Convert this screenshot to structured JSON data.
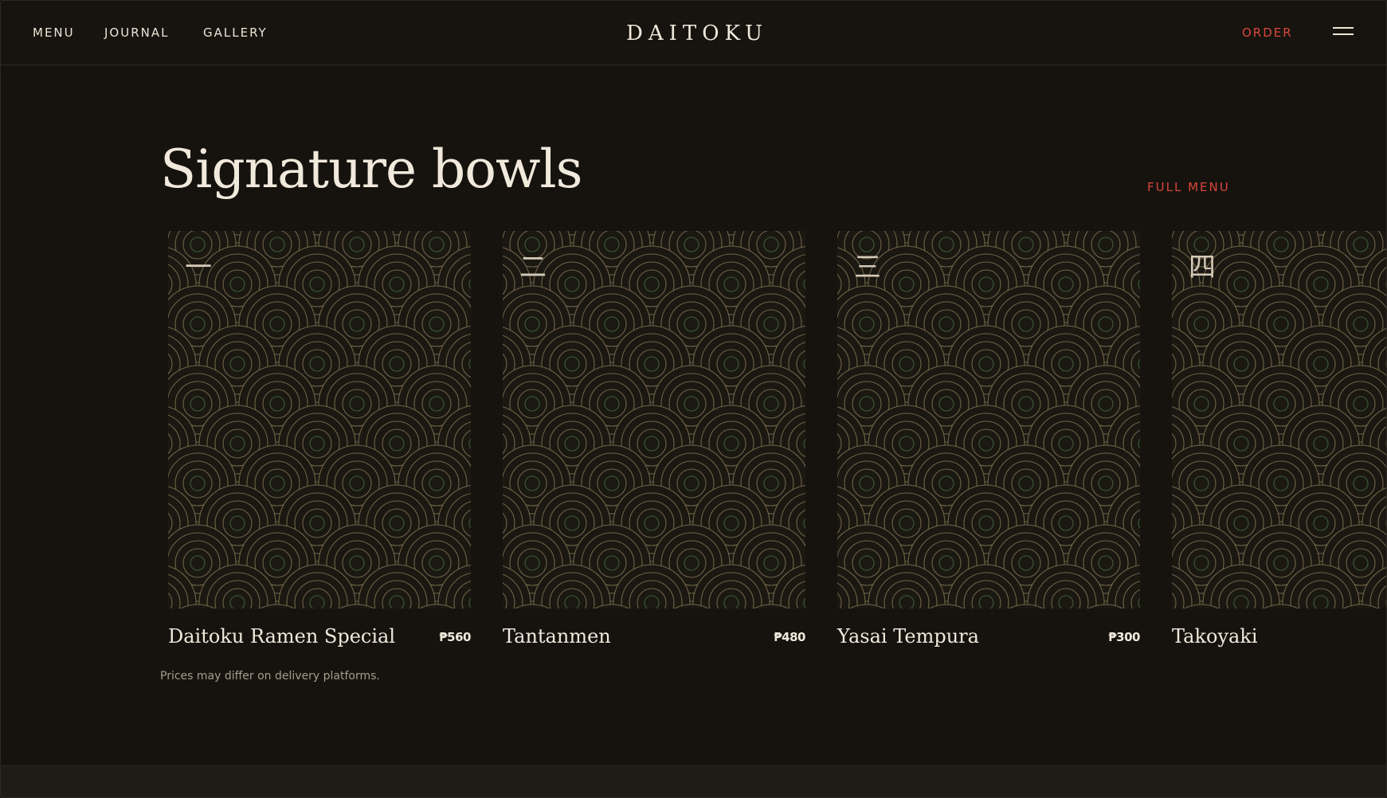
{
  "header": {
    "nav": [
      "MENU",
      "JOURNAL",
      "GALLERY"
    ],
    "brand": "DAITOKU",
    "order_label": "ORDER",
    "menu_icon": "hamburger-icon"
  },
  "section": {
    "title": "Signature bowls",
    "full_menu_label": "FULL MENU",
    "disclaimer": "Prices may differ on delivery platforms."
  },
  "cards": [
    {
      "numeral": "一",
      "name": "Daitoku Ramen Special",
      "price": "₱560"
    },
    {
      "numeral": "二",
      "name": "Tantanmen",
      "price": "₱480"
    },
    {
      "numeral": "三",
      "name": "Yasai Tempura",
      "price": "₱300"
    },
    {
      "numeral": "四",
      "name": "Takoyaki",
      "price": ""
    }
  ],
  "colors": {
    "background": "#16130f",
    "accent_red": "#d9463b",
    "text": "#ece4d6",
    "pattern_ring": "#6e6346",
    "pattern_center": "#3d5a3a"
  }
}
